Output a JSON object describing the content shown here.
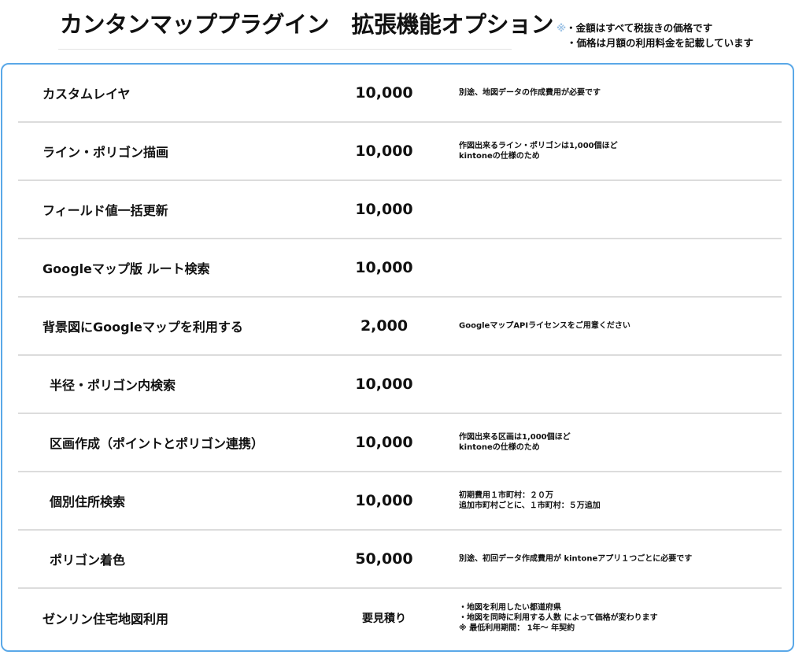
{
  "header": {
    "title": "カンタンマッププラグイン　拡張機能オプション",
    "notes": {
      "mark": "※",
      "line1": "・金額はすべて税抜きの価格です",
      "line2": "・価格は月額の利用料金を記載しています"
    }
  },
  "options": [
    {
      "name": "カスタムレイヤ",
      "price": "10,000",
      "desc": [
        "別途、地図データの作成費用が必要です"
      ]
    },
    {
      "name": "ライン・ポリゴン描画",
      "price": "10,000",
      "desc": [
        "作図出来るライン・ポリゴンは1,000個ほど",
        "kintoneの仕様のため"
      ]
    },
    {
      "name": "フィールド値一括更新",
      "price": "10,000",
      "desc": []
    },
    {
      "name": "Googleマップ版 ルート検索",
      "price": "10,000",
      "desc": []
    },
    {
      "name": "背景図にGoogleマップを利用する",
      "price": "2,000",
      "desc": [
        "GoogleマップAPIライセンスをご用意ください"
      ]
    },
    {
      "name": "半径・ポリゴン内検索",
      "price": "10,000",
      "desc": []
    },
    {
      "name": "区画作成（ポイントとポリゴン連携）",
      "price": "10,000",
      "desc": [
        "作図出来る区画は1,000個ほど",
        "kintoneの仕様のため"
      ]
    },
    {
      "name": "個別住所検索",
      "price": "10,000",
      "desc": [
        "初期費用１市町村：２０万",
        "追加市町村ごとに、１市町村：５万追加"
      ]
    },
    {
      "name": "ポリゴン着色",
      "price": "50,000",
      "desc": [
        "別途、初回データ作成費用が kintoneアプリ１つごとに必要です"
      ]
    },
    {
      "name": "ゼンリン住宅地図利用",
      "price": "要見積り",
      "desc": [
        "・地図を利用したい都道府県",
        "・地図を同時に利用する人数 によって価格が変わります",
        "※ 最低利用期間：  1年〜    年契約"
      ]
    }
  ]
}
